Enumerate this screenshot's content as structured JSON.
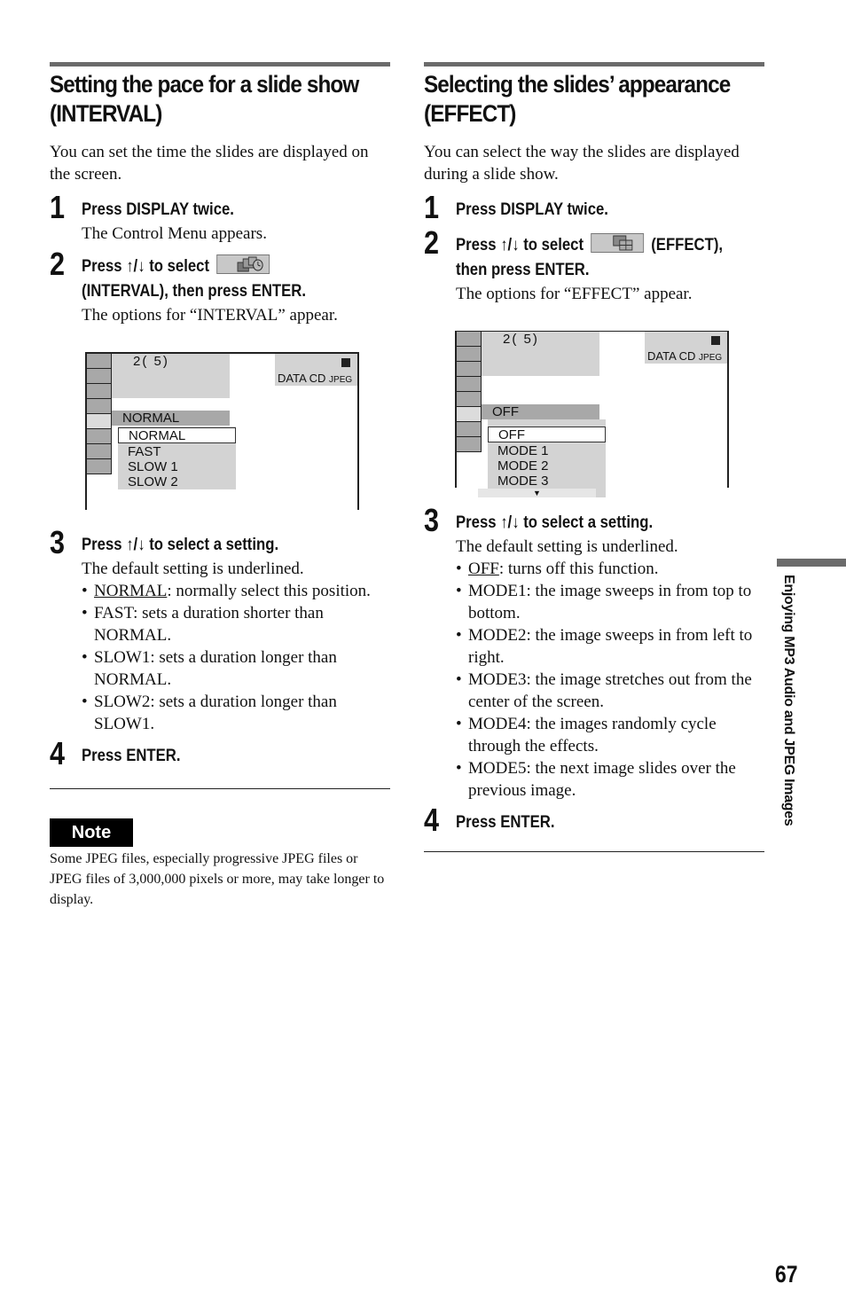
{
  "left": {
    "heading": [
      "Setting the pace for a slide show",
      "(INTERVAL)"
    ],
    "intro": "You can set the time the slides are displayed on the screen.",
    "steps": [
      {
        "num": "1",
        "title": "Press DISPLAY twice.",
        "body": "The Control Menu appears."
      },
      {
        "num": "2",
        "title_pre": "Press ↑/↓ to select",
        "title_post": "(INTERVAL), then press ENTER.",
        "icon": "interval-icon",
        "body": "The options for “INTERVAL” appear."
      },
      {
        "num": "3",
        "title": "Press ↑/↓ to select a setting.",
        "body": "The default setting is underlined."
      },
      {
        "num": "4",
        "title": "Press ENTER."
      }
    ],
    "screen": {
      "track": "2(   5)",
      "disc": "DATA CD",
      "disc_sub": "JPEG",
      "current": "NORMAL",
      "options": [
        "NORMAL",
        "FAST",
        "SLOW 1",
        "SLOW 2"
      ]
    },
    "bullets": [
      {
        "key": "NORMAL",
        "text": ": normally select this position."
      },
      {
        "key": "",
        "text": "FAST: sets a duration shorter than NORMAL."
      },
      {
        "key": "",
        "text": "SLOW1: sets a duration longer than NORMAL."
      },
      {
        "key": "",
        "text": "SLOW2: sets a duration longer than SLOW1."
      }
    ],
    "note": {
      "label": "Note",
      "text": "Some JPEG files, especially progressive JPEG files or JPEG files of 3,000,000 pixels or more, may take longer to display."
    }
  },
  "right": {
    "heading": [
      "Selecting the slides’ appearance",
      "(EFFECT)"
    ],
    "intro": "You can select the way the slides are displayed during a slide show.",
    "steps": [
      {
        "num": "1",
        "title": "Press DISPLAY twice."
      },
      {
        "num": "2",
        "title_pre": "Press ↑/↓ to select",
        "title_post": "(EFFECT),",
        "title_line2": "then press ENTER.",
        "icon": "effect-icon",
        "body": "The options for “EFFECT” appear."
      },
      {
        "num": "3",
        "title": "Press ↑/↓ to select a setting.",
        "body": "The default setting is underlined."
      },
      {
        "num": "4",
        "title": "Press ENTER."
      }
    ],
    "screen": {
      "track": "2(   5)",
      "disc": "DATA CD",
      "disc_sub": "JPEG",
      "current": "OFF",
      "options": [
        "OFF",
        "MODE 1",
        "MODE 2",
        "MODE 3"
      ],
      "more": "▼"
    },
    "bullets": [
      {
        "key": "OFF",
        "text": ": turns off this function."
      },
      {
        "key": "",
        "text": "MODE1: the image sweeps in from top to bottom."
      },
      {
        "key": "",
        "text": "MODE2: the image sweeps in from left to right."
      },
      {
        "key": "",
        "text": "MODE3: the image stretches out from the center of the screen."
      },
      {
        "key": "",
        "text": "MODE4: the images randomly cycle through the effects."
      },
      {
        "key": "",
        "text": "MODE5: the next image slides over the previous image."
      }
    ]
  },
  "side_tab": "Enjoying MP3 Audio and JPEG Images",
  "page_number": "67"
}
